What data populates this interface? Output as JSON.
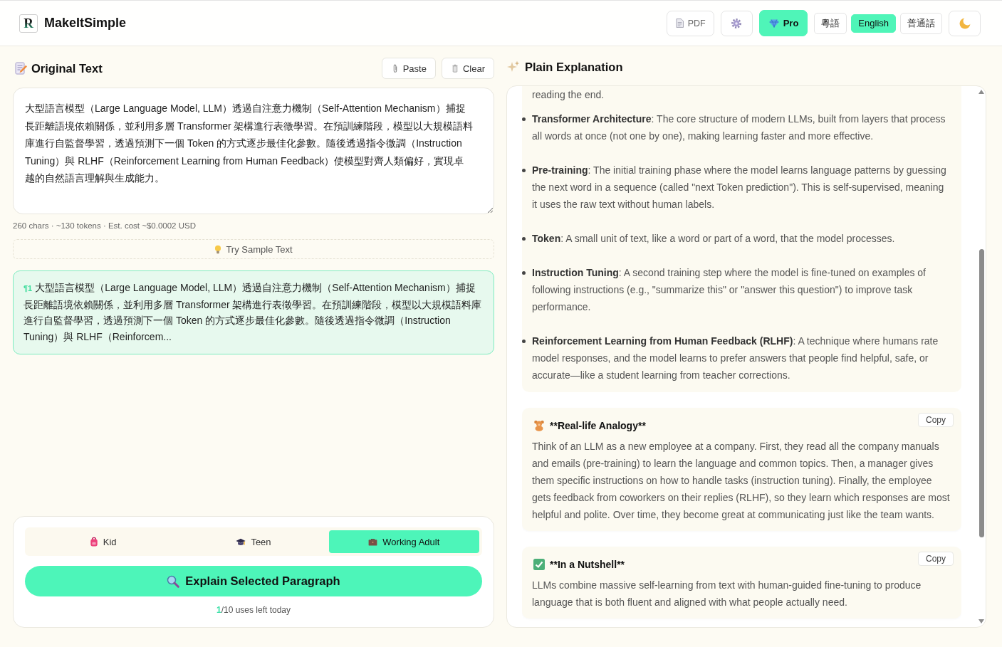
{
  "header": {
    "logo_mark": "R",
    "app_name": "MakeItSimple",
    "pdf_button": "PDF",
    "pro_button": "Pro",
    "languages": [
      {
        "label": "粵語",
        "selected": false
      },
      {
        "label": "English",
        "selected": true
      },
      {
        "label": "普通話",
        "selected": false
      }
    ]
  },
  "original": {
    "title": "Original Text",
    "paste_button": "Paste",
    "clear_button": "Clear",
    "text": "大型語言模型（Large Language Model, LLM）透過自注意力機制（Self-Attention Mechanism）捕捉長距離語境依賴關係，並利用多層 Transformer 架構進行表徵學習。在預訓練階段，模型以大規模語料庫進行自監督學習，透過預測下一個 Token 的方式逐步最佳化參數。隨後透過指令微調（Instruction Tuning）與 RLHF（Reinforcement Learning from Human Feedback）使模型對齊人類偏好，實現卓越的自然語言理解與生成能力。",
    "stats": "260 chars · ~130 tokens · Est. cost ~$0.0002 USD",
    "sample_button": "Try Sample Text",
    "paragraphs": [
      {
        "label": "¶1",
        "text": "大型語言模型（Large Language Model, LLM）透過自注意力機制（Self-Attention Mechanism）捕捉長距離語境依賴關係，並利用多層 Transformer 架構進行表徵學習。在預訓練階段，模型以大規模語料庫進行自監督學習，透過預測下一個 Token 的方式逐步最佳化參數。隨後透過指令微調（Instruction Tuning）與 RLHF（Reinforcem...",
        "selected": true
      }
    ]
  },
  "controls": {
    "audiences": [
      {
        "kind": "kid",
        "label": "Kid",
        "selected": false
      },
      {
        "kind": "teen",
        "label": "Teen",
        "selected": false
      },
      {
        "kind": "adult",
        "label": "Working Adult",
        "selected": true
      }
    ],
    "explain_button": "Explain Selected Paragraph",
    "usage": {
      "remaining": "1",
      "suffix": "/10 uses left today"
    }
  },
  "explanation": {
    "title": "Plain Explanation",
    "sections": [
      {
        "kind": "terms",
        "intro": "reading the end.",
        "items": [
          "**Transformer Architecture**: The core structure of modern LLMs, built from layers that process all words at once (not one by one), making learning faster and more effective.",
          "**Pre-training**: The initial training phase where the model learns language patterns by guessing the next word in a sequence (called \"next Token prediction\"). This is self-supervised, meaning it uses the raw text without human labels.",
          "**Token**: A small unit of text, like a word or part of a word, that the model processes.",
          "**Instruction Tuning**: A second training step where the model is fine-tuned on examples of following instructions (e.g., \"summarize this\" or \"answer this question\") to improve task performance.",
          "**Reinforcement Learning from Human Feedback (RLHF)**: A technique where humans rate model responses, and the model learns to prefer answers that people find helpful, safe, or accurate—like a student learning from teacher corrections."
        ]
      },
      {
        "kind": "analogy",
        "heading": "**Real-life Analogy**",
        "copy_button": "Copy",
        "text": "Think of an LLM as a new employee at a company. First, they read all the company manuals and emails (pre-training) to learn the language and common topics. Then, a manager gives them specific instructions on how to handle tasks (instruction tuning). Finally, the employee gets feedback from coworkers on their replies (RLHF), so they learn which responses are most helpful and polite. Over time, they become great at communicating just like the team wants."
      },
      {
        "kind": "summary",
        "heading": "**In a Nutshell**",
        "copy_button": "Copy",
        "text": "LLMs combine massive self-learning from text with human-guided fine-tuning to produce language that is both fluent and aligned with what people actually need."
      }
    ]
  }
}
